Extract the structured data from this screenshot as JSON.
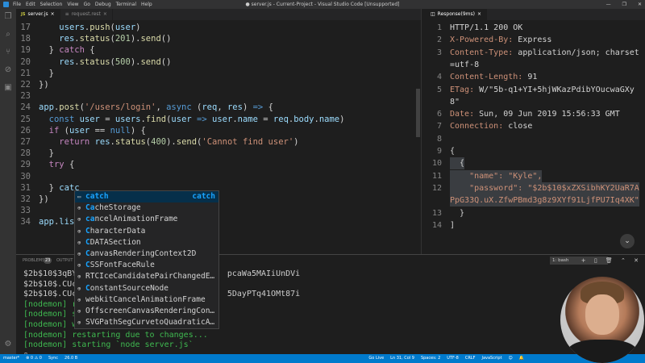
{
  "window": {
    "title": "● server.js - Current-Project - Visual Studio Code [Unsupported]",
    "menu": [
      "File",
      "Edit",
      "Selection",
      "View",
      "Go",
      "Debug",
      "Terminal",
      "Help"
    ],
    "controls": [
      "—",
      "❐",
      "✕"
    ]
  },
  "tabs": {
    "left": [
      {
        "icon": "JS",
        "label": "server.js"
      },
      {
        "icon": "≡",
        "label": "request.rest"
      }
    ],
    "right": [
      {
        "icon": "◫",
        "label": "Response(9ms)"
      }
    ]
  },
  "editor": {
    "lines": [
      {
        "n": "17",
        "segs": [
          [
            "punc",
            "    "
          ],
          [
            "var",
            "users"
          ],
          [
            "punc",
            "."
          ],
          [
            "fn",
            "push"
          ],
          [
            "punc",
            "("
          ],
          [
            "var",
            "user"
          ],
          [
            "punc",
            ")"
          ]
        ]
      },
      {
        "n": "18",
        "segs": [
          [
            "punc",
            "    "
          ],
          [
            "var",
            "res"
          ],
          [
            "punc",
            "."
          ],
          [
            "fn",
            "status"
          ],
          [
            "punc",
            "("
          ],
          [
            "num",
            "201"
          ],
          [
            "punc",
            ")."
          ],
          [
            "fn",
            "send"
          ],
          [
            "punc",
            "()"
          ]
        ]
      },
      {
        "n": "19",
        "segs": [
          [
            "punc",
            "  } "
          ],
          [
            "ctl",
            "catch"
          ],
          [
            "punc",
            " {"
          ]
        ]
      },
      {
        "n": "20",
        "segs": [
          [
            "punc",
            "    "
          ],
          [
            "var",
            "res"
          ],
          [
            "punc",
            "."
          ],
          [
            "fn",
            "status"
          ],
          [
            "punc",
            "("
          ],
          [
            "num",
            "500"
          ],
          [
            "punc",
            ")."
          ],
          [
            "fn",
            "send"
          ],
          [
            "punc",
            "()"
          ]
        ]
      },
      {
        "n": "21",
        "segs": [
          [
            "punc",
            "  }"
          ]
        ]
      },
      {
        "n": "22",
        "segs": [
          [
            "punc",
            "})"
          ]
        ]
      },
      {
        "n": "23",
        "segs": []
      },
      {
        "n": "24",
        "segs": [
          [
            "var",
            "app"
          ],
          [
            "punc",
            "."
          ],
          [
            "fn",
            "post"
          ],
          [
            "punc",
            "("
          ],
          [
            "str",
            "'/users/login'"
          ],
          [
            "punc",
            ", "
          ],
          [
            "kw",
            "async"
          ],
          [
            "punc",
            " ("
          ],
          [
            "var",
            "req"
          ],
          [
            "punc",
            ", "
          ],
          [
            "var",
            "res"
          ],
          [
            "punc",
            ") "
          ],
          [
            "kw",
            "=>"
          ],
          [
            "punc",
            " {"
          ]
        ]
      },
      {
        "n": "25",
        "segs": [
          [
            "punc",
            "  "
          ],
          [
            "kw",
            "const"
          ],
          [
            "punc",
            " "
          ],
          [
            "var",
            "user"
          ],
          [
            "punc",
            " = "
          ],
          [
            "var",
            "users"
          ],
          [
            "punc",
            "."
          ],
          [
            "fn",
            "find"
          ],
          [
            "punc",
            "("
          ],
          [
            "var",
            "user"
          ],
          [
            "punc",
            " "
          ],
          [
            "kw",
            "=>"
          ],
          [
            "punc",
            " "
          ],
          [
            "var",
            "user"
          ],
          [
            "punc",
            "."
          ],
          [
            "var",
            "name"
          ],
          [
            "punc",
            " = "
          ],
          [
            "var",
            "req"
          ],
          [
            "punc",
            "."
          ],
          [
            "var",
            "body"
          ],
          [
            "punc",
            "."
          ],
          [
            "var",
            "name"
          ],
          [
            "punc",
            ")"
          ]
        ]
      },
      {
        "n": "26",
        "segs": [
          [
            "punc",
            "  "
          ],
          [
            "ctl",
            "if"
          ],
          [
            "punc",
            " ("
          ],
          [
            "var",
            "user"
          ],
          [
            "punc",
            " == "
          ],
          [
            "kw",
            "null"
          ],
          [
            "punc",
            ") {"
          ]
        ]
      },
      {
        "n": "27",
        "segs": [
          [
            "punc",
            "    "
          ],
          [
            "ctl",
            "return"
          ],
          [
            "punc",
            " "
          ],
          [
            "var",
            "res"
          ],
          [
            "punc",
            "."
          ],
          [
            "fn",
            "status"
          ],
          [
            "punc",
            "("
          ],
          [
            "num",
            "400"
          ],
          [
            "punc",
            ")."
          ],
          [
            "fn",
            "send"
          ],
          [
            "punc",
            "("
          ],
          [
            "str",
            "'Cannot find user'"
          ],
          [
            "punc",
            ")"
          ]
        ]
      },
      {
        "n": "28",
        "segs": [
          [
            "punc",
            "  }"
          ]
        ]
      },
      {
        "n": "29",
        "segs": [
          [
            "punc",
            "  "
          ],
          [
            "ctl",
            "try"
          ],
          [
            "punc",
            " {"
          ]
        ]
      },
      {
        "n": "30",
        "segs": []
      },
      {
        "n": "31",
        "segs": [
          [
            "punc",
            "  } "
          ],
          [
            "var",
            "catc"
          ]
        ]
      },
      {
        "n": "32",
        "segs": [
          [
            "punc",
            "})"
          ]
        ]
      },
      {
        "n": "33",
        "segs": []
      },
      {
        "n": "34",
        "segs": [
          [
            "var",
            "app"
          ],
          [
            "punc",
            "."
          ],
          [
            "var",
            "list"
          ]
        ]
      }
    ]
  },
  "suggest": {
    "items": [
      {
        "icon": "▭",
        "pre": "",
        "hl": "catch",
        "post": "",
        "detail": "catch"
      },
      {
        "icon": "⊕",
        "pre": "",
        "hl": "Ca",
        "post": "cheStorage",
        "detail": ""
      },
      {
        "icon": "⊕",
        "pre": "",
        "hl": "ca",
        "post": "ncelAnimationFrame",
        "detail": ""
      },
      {
        "icon": "⊕",
        "pre": "",
        "hl": "C",
        "post": "haracterData",
        "detail": ""
      },
      {
        "icon": "⊕",
        "pre": "",
        "hl": "C",
        "post": "DATASection",
        "detail": ""
      },
      {
        "icon": "⊕",
        "pre": "",
        "hl": "C",
        "post": "anvasRenderingContext2D",
        "detail": ""
      },
      {
        "icon": "⊕",
        "pre": "",
        "hl": "C",
        "post": "SSFontFaceRule",
        "detail": ""
      },
      {
        "icon": "⊕",
        "pre": "",
        "hl": "",
        "post": "RTCIceCandidatePairChangedE…",
        "detail": ""
      },
      {
        "icon": "⊕",
        "pre": "",
        "hl": "C",
        "post": "onstantSourceNode",
        "detail": ""
      },
      {
        "icon": "⊕",
        "pre": "",
        "hl": "",
        "post": "webkitCancelAnimationFrame",
        "detail": ""
      },
      {
        "icon": "⊕",
        "pre": "",
        "hl": "",
        "post": "OffscreenCanvasRenderingCon…",
        "detail": ""
      },
      {
        "icon": "⊕",
        "pre": "",
        "hl": "",
        "post": "SVGPathSegCurvetoQuadraticA…",
        "detail": ""
      }
    ]
  },
  "response": {
    "lines": [
      {
        "n": "1",
        "k": "",
        "v": "HTTP/1.1 200 OK"
      },
      {
        "n": "2",
        "k": "X-Powered-By:",
        "v": " Express"
      },
      {
        "n": "3",
        "k": "Content-Type:",
        "v": " application/json; charset"
      },
      {
        "n": "",
        "k": "",
        "v": "=utf-8"
      },
      {
        "n": "4",
        "k": "Content-Length:",
        "v": " 91"
      },
      {
        "n": "5",
        "k": "ETag:",
        "v": " W/\"5b-q1+YI+5hjWKazPdibYOucwaGXy"
      },
      {
        "n": "",
        "k": "",
        "v": "8\""
      },
      {
        "n": "6",
        "k": "Date:",
        "v": " Sun, 09 Jun 2019 15:56:33 GMT"
      },
      {
        "n": "7",
        "k": "Connection:",
        "v": " close"
      },
      {
        "n": "8",
        "k": "",
        "v": ""
      },
      {
        "n": "9",
        "k": "",
        "v": "{"
      },
      {
        "n": "10",
        "k": "",
        "v": "  {"
      },
      {
        "n": "11",
        "k": "",
        "v": "    \"name\": \"Kyle\","
      },
      {
        "n": "12",
        "k": "",
        "v": "    \"password\": \"$2b$10$xZXSibhKY2UaR7A"
      },
      {
        "n": "",
        "k": "",
        "v": "PpG33Q.uX.ZfwPBmd3g8z9XYf91LjfPU7Iq4XK\""
      },
      {
        "n": "13",
        "k": "",
        "v": "  }"
      },
      {
        "n": "14",
        "k": "",
        "v": "]"
      }
    ]
  },
  "panel": {
    "tabs": [
      "PROBLEMS",
      "OUTPUT"
    ],
    "problems_count": "23",
    "terminal_select": "1: bash",
    "icons": "+ ▯ 🗑 ⌃ ✕"
  },
  "terminal": {
    "lines": [
      {
        "cls": "",
        "t": "$2b$10$3qBYT                              pcaWa5MAIiUnDVi"
      },
      {
        "cls": "",
        "t": "$2b$10$.CUca"
      },
      {
        "cls": "",
        "t": "$2b$10$.CUca                              5DayPTq41OMt87i"
      },
      {
        "cls": "nm",
        "t": "[nodemon] re"
      },
      {
        "cls": "nm",
        "t": "[nodemon] st"
      },
      {
        "cls": "nm",
        "t": "[nodemon] watching: *.*"
      },
      {
        "cls": "nm",
        "t": "[nodemon] restarting due to changes..."
      },
      {
        "cls": "nm",
        "t": "[nodemon] starting `node server.js`"
      },
      {
        "cls": "",
        "t": "▯"
      }
    ]
  },
  "statusbar": {
    "left": [
      "master*",
      "⊗ 0 ⚠ 0",
      "Sync",
      "26.0 B"
    ],
    "right": [
      "Go Live",
      "Ln 31, Col 9",
      "Spaces: 2",
      "UTF-8",
      "CRLF",
      "JavaScript",
      "☺",
      "🔔"
    ]
  }
}
